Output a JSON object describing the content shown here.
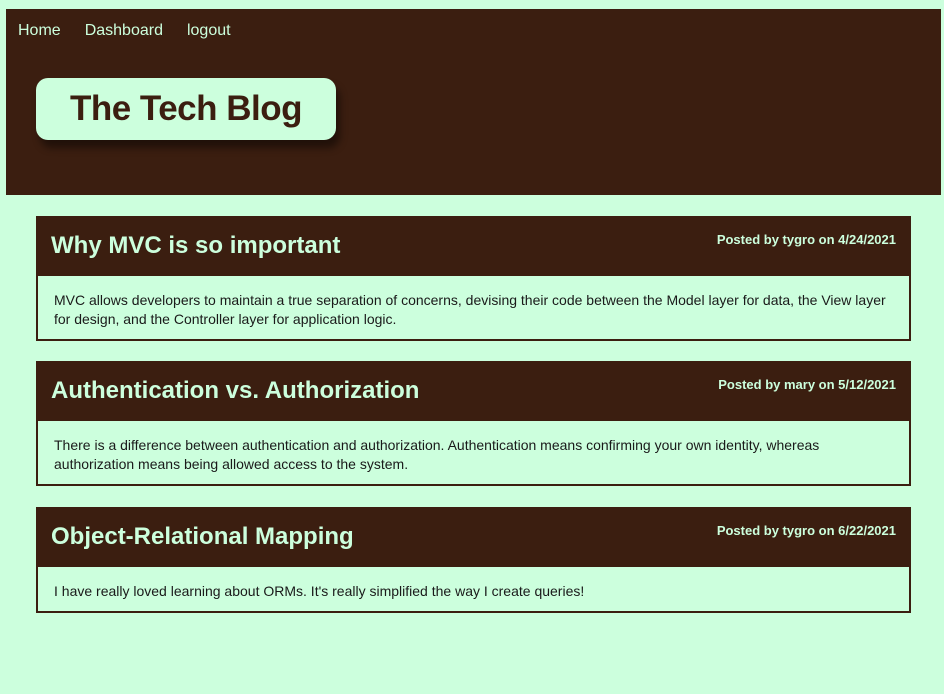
{
  "nav": {
    "home": "Home",
    "dashboard": "Dashboard",
    "logout": "logout"
  },
  "site": {
    "title": "The Tech Blog"
  },
  "posts": [
    {
      "title": "Why MVC is so important",
      "meta": "Posted by tygro on 4/24/2021",
      "body": "MVC allows developers to maintain a true separation of concerns, devising their code between the Model layer for data, the View layer for design, and the Controller layer for application logic."
    },
    {
      "title": "Authentication vs. Authorization",
      "meta": "Posted by mary on 5/12/2021",
      "body": "There is a difference between authentication and authorization. Authentication means confirming your own identity, whereas authorization means being allowed access to the system."
    },
    {
      "title": "Object-Relational Mapping",
      "meta": "Posted by tygro on 6/22/2021",
      "body": "I have really loved learning about ORMs. It's really simplified the way I create queries!"
    }
  ],
  "colors": {
    "background": "#ccffdd",
    "header": "#3b1e10"
  }
}
